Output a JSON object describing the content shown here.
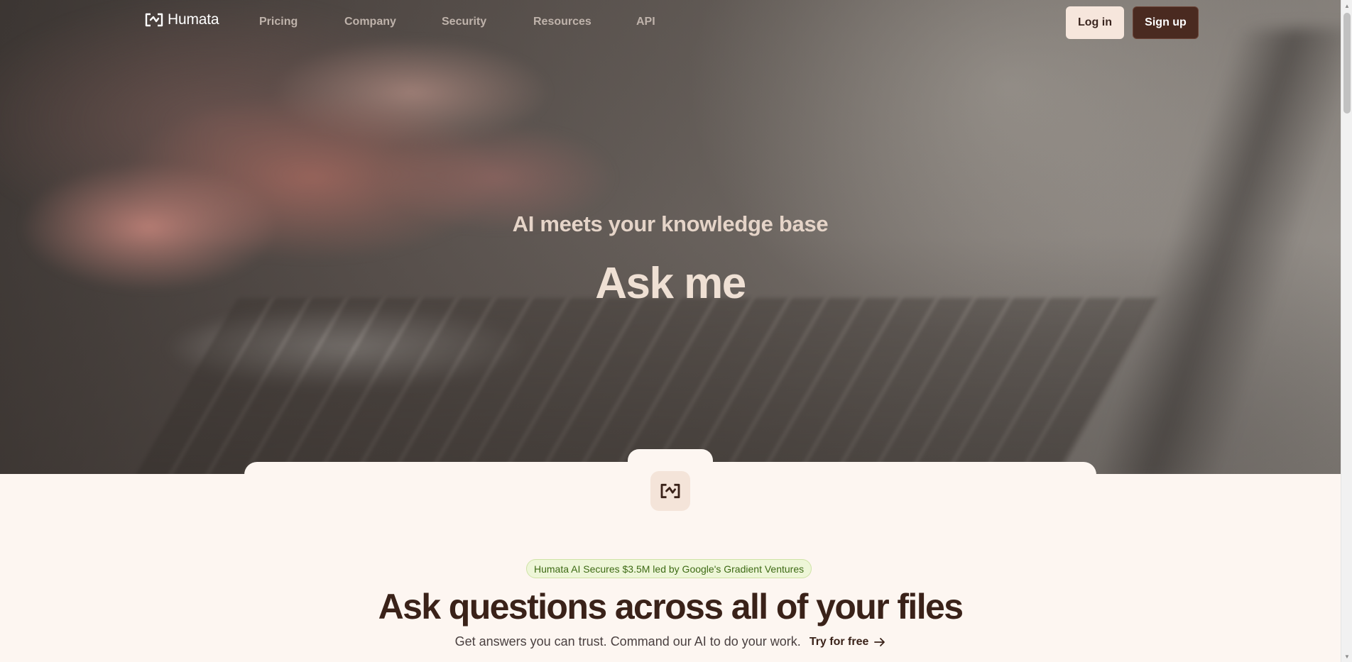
{
  "nav": {
    "logo_text": "Humata",
    "links": [
      "Pricing",
      "Company",
      "Security",
      "Resources",
      "API"
    ],
    "login_label": "Log in",
    "signup_label": "Sign up"
  },
  "hero": {
    "subtitle": "AI meets your knowledge base",
    "title": "Ask me"
  },
  "content": {
    "announcement": "Humata AI Secures $3.5M led by Google's Gradient Ventures",
    "heading": "Ask questions across all of your files",
    "subtext": "Get answers you can trust. Command our AI to do your work.",
    "cta_label": "Try for free"
  },
  "colors": {
    "brand_dark": "#4a2a20",
    "brand_light": "#f6e6dc",
    "page_bg": "#fdf6f1",
    "announce_green": "#3d6a14"
  },
  "icons": {
    "logo": "humata-logo-icon",
    "cta": "arrow-right-icon"
  }
}
